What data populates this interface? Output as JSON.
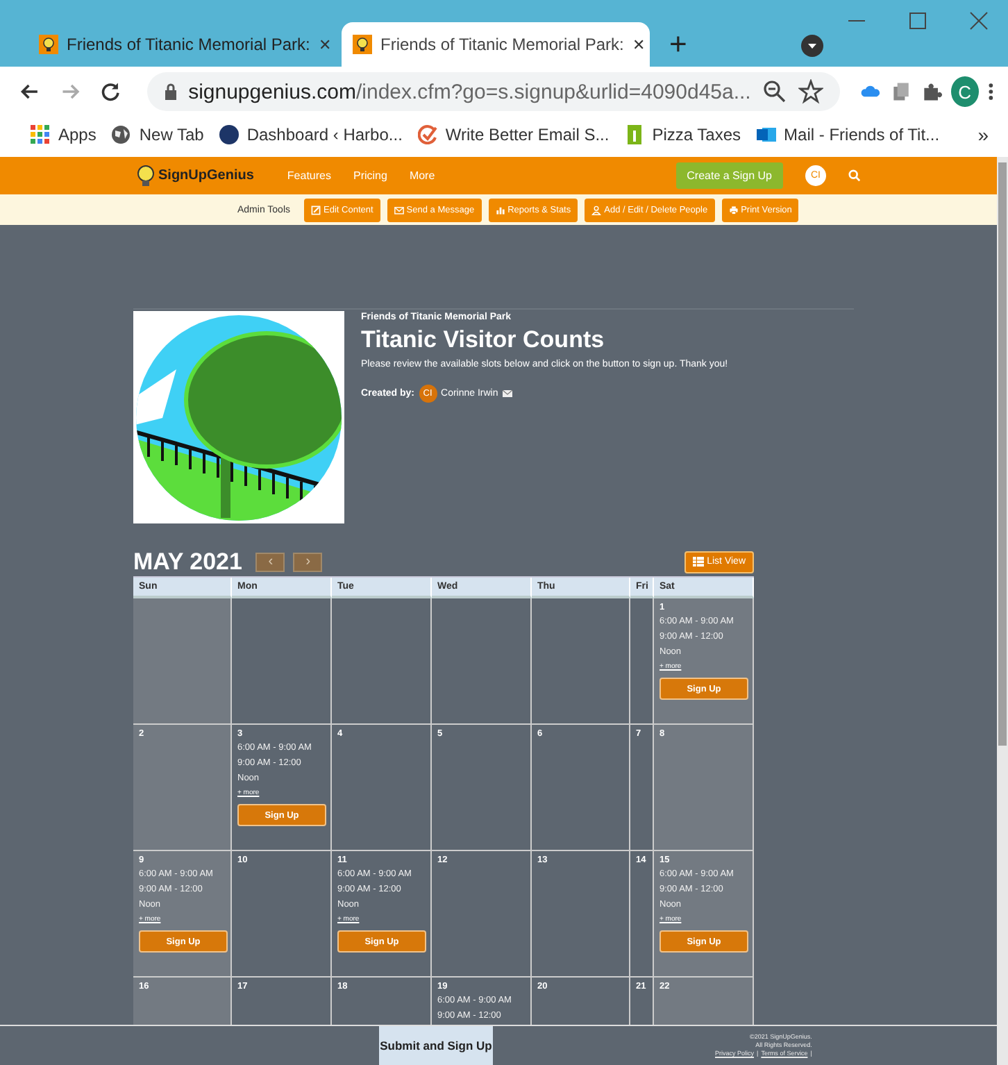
{
  "browser": {
    "tabs": [
      {
        "title": "Friends of Titanic Memorial Park:",
        "close": "✕",
        "selected": false
      },
      {
        "title": "Friends of Titanic Memorial Park:",
        "close": "✕",
        "selected": true
      }
    ],
    "new_tab": "+",
    "url_domain": "signupgenius.com",
    "url_path": "/index.cfm?go=s.signup&urlid=4090d45a...",
    "profile": "C",
    "bookmarks": [
      {
        "label": "Apps",
        "kind": "apps"
      },
      {
        "label": "New Tab",
        "kind": "globe"
      },
      {
        "label": "Dashboard ‹ Harbo...",
        "kind": "harbour"
      },
      {
        "label": "Write Better Email S...",
        "kind": "check"
      },
      {
        "label": "Pizza Taxes",
        "kind": "doc"
      },
      {
        "label": "Mail - Friends of Tit...",
        "kind": "mail"
      }
    ],
    "bookmarks_more": "»"
  },
  "site_nav": {
    "logo": "SignUpGenius",
    "links": [
      "Features",
      "Pricing",
      "More"
    ],
    "create_button": "Create a Sign Up",
    "avatar": "CI"
  },
  "admin_tools": {
    "label": "Admin Tools",
    "buttons": [
      {
        "label": "Edit Content",
        "kind": "edit"
      },
      {
        "label": "Send a Message",
        "kind": "mail"
      },
      {
        "label": "Reports & Stats",
        "kind": "chart"
      },
      {
        "label": "Add / Edit / Delete People",
        "kind": "person"
      },
      {
        "label": "Print Version",
        "kind": "print"
      }
    ]
  },
  "signup": {
    "organization": "Friends of Titanic Memorial Park",
    "title": "Titanic Visitor Counts",
    "description": "Please review the available slots below and click on the button to sign up. Thank you!",
    "created_by_label": "Created by:",
    "creator_initials": "CI",
    "creator_name": "Corinne Irwin"
  },
  "calendar": {
    "month": "MAY 2021",
    "prev": "‹",
    "next": "›",
    "list_view": "List View",
    "columns": [
      "Sun",
      "Mon",
      "Tue",
      "Wed",
      "Thu",
      "Fri",
      "Sat"
    ],
    "weeks": [
      [
        {
          "kind": "blank"
        },
        {
          "kind": "blank"
        },
        {
          "kind": "blank"
        },
        {
          "kind": "blank"
        },
        {
          "kind": "blank"
        },
        {
          "kind": "blank"
        },
        {
          "kind": "day",
          "day": "1",
          "slots": [
            "6:00 AM - 9:00 AM",
            "9:00 AM - 12:00",
            "Noon"
          ],
          "more": "+ more",
          "button": "Sign Up"
        }
      ],
      [
        {
          "kind": "day",
          "day": "2"
        },
        {
          "kind": "day",
          "day": "3",
          "slots": [
            "6:00 AM - 9:00 AM",
            "9:00 AM - 12:00",
            "Noon"
          ],
          "more": "+ more",
          "button": "Sign Up"
        },
        {
          "kind": "day",
          "day": "4"
        },
        {
          "kind": "day",
          "day": "5"
        },
        {
          "kind": "day",
          "day": "6"
        },
        {
          "kind": "day",
          "day": "7"
        },
        {
          "kind": "day",
          "day": "8"
        }
      ],
      [
        {
          "kind": "day",
          "day": "9",
          "slots": [
            "6:00 AM - 9:00 AM",
            "9:00 AM - 12:00",
            "Noon"
          ],
          "more": "+ more",
          "button": "Sign Up"
        },
        {
          "kind": "day",
          "day": "10"
        },
        {
          "kind": "day",
          "day": "11",
          "slots": [
            "6:00 AM - 9:00 AM",
            "9:00 AM - 12:00",
            "Noon"
          ],
          "more": "+ more",
          "button": "Sign Up"
        },
        {
          "kind": "day",
          "day": "12"
        },
        {
          "kind": "day",
          "day": "13"
        },
        {
          "kind": "day",
          "day": "14"
        },
        {
          "kind": "day",
          "day": "15",
          "slots": [
            "6:00 AM - 9:00 AM",
            "9:00 AM - 12:00",
            "Noon"
          ],
          "more": "+ more",
          "button": "Sign Up"
        }
      ],
      [
        {
          "kind": "day",
          "day": "16"
        },
        {
          "kind": "day",
          "day": "17"
        },
        {
          "kind": "day",
          "day": "18"
        },
        {
          "kind": "day",
          "day": "19",
          "slots": [
            "6:00 AM - 9:00 AM",
            "9:00 AM - 12:00"
          ]
        },
        {
          "kind": "day",
          "day": "20"
        },
        {
          "kind": "day",
          "day": "21"
        },
        {
          "kind": "day",
          "day": "22"
        }
      ]
    ]
  },
  "footer": {
    "submit": "Submit and Sign Up",
    "copyright": [
      "©2021 SignUpGenius.",
      "All Rights Reserved."
    ],
    "links": [
      {
        "label": "Privacy Policy",
        "separator": "|"
      },
      {
        "label": "Terms of Service",
        "separator": "|"
      }
    ]
  }
}
